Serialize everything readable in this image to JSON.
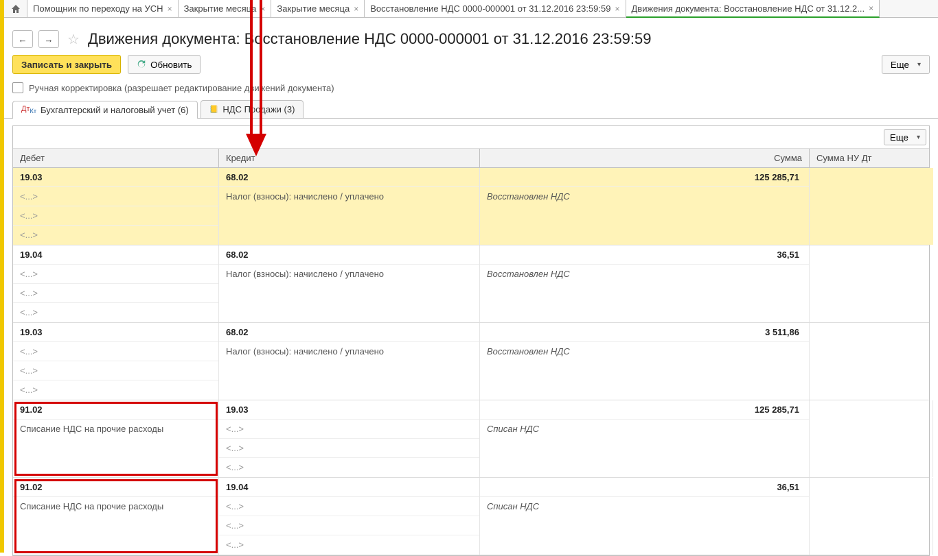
{
  "tabs": [
    "Помощник по переходу на УСН",
    "Закрытие месяца",
    "Закрытие месяца",
    "Восстановление НДС 0000-000001 от 31.12.2016 23:59:59",
    "Движения документа: Восстановление НДС от 31.12.2..."
  ],
  "header": {
    "title": "Движения документа: Восстановление НДС 0000-000001 от 31.12.2016 23:59:59"
  },
  "toolbar": {
    "save_and_close": "Записать и закрыть",
    "refresh": "Обновить",
    "more": "Еще"
  },
  "checkbox_label": "Ручная корректировка (разрешает редактирование движений документа)",
  "subtabs": {
    "first": "Бухгалтерский и налоговый учет (6)",
    "second": "НДС Продажи (3)"
  },
  "grid": {
    "more": "Еще",
    "headers": {
      "debit": "Дебет",
      "credit": "Кредит",
      "sum": "Сумма",
      "sum_nu": "Сумма НУ Дт"
    },
    "placeholder": "<...>",
    "rows": [
      {
        "yellow": true,
        "debit_acc": "19.03",
        "credit_acc": "68.02",
        "credit_desc": "Налог (взносы): начислено / уплачено",
        "sum_title": "Восстановлен НДС",
        "amount": "125 285,71"
      },
      {
        "yellow": false,
        "debit_acc": "19.04",
        "credit_acc": "68.02",
        "credit_desc": "Налог (взносы): начислено / уплачено",
        "sum_title": "Восстановлен НДС",
        "amount": "36,51"
      },
      {
        "yellow": false,
        "debit_acc": "19.03",
        "credit_acc": "68.02",
        "credit_desc": "Налог (взносы): начислено / уплачено",
        "sum_title": "Восстановлен НДС",
        "amount": "3 511,86"
      },
      {
        "yellow": false,
        "debit_acc": "91.02",
        "debit_desc": "Списание НДС на прочие расходы",
        "credit_acc": "19.03",
        "credit_desc_ph": true,
        "sum_title": "Списан НДС",
        "amount": "125 285,71",
        "redbox": true
      },
      {
        "yellow": false,
        "debit_acc": "91.02",
        "debit_desc": "Списание НДС на прочие расходы",
        "credit_acc": "19.04",
        "credit_desc_ph": true,
        "sum_title": "Списан НДС",
        "amount": "36,51",
        "redbox": true
      }
    ]
  }
}
